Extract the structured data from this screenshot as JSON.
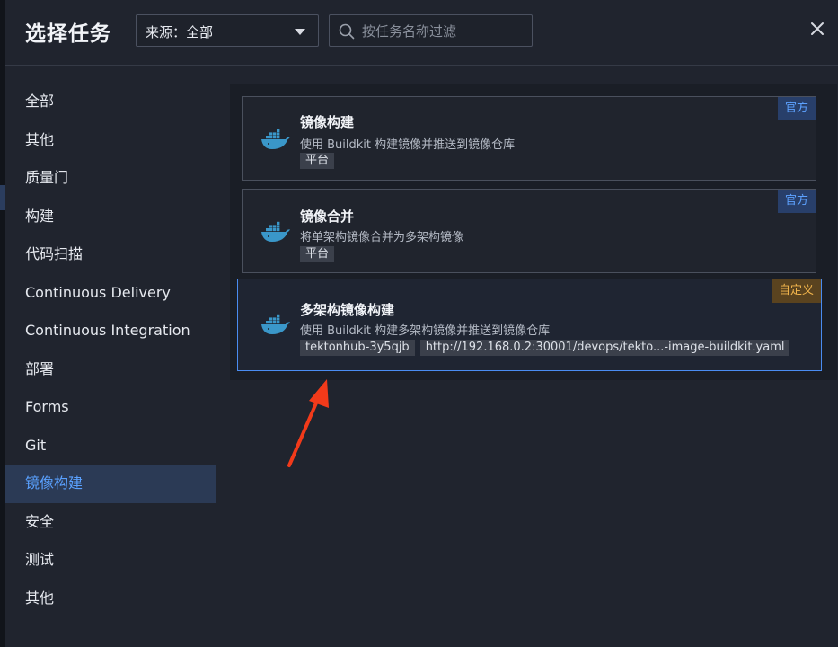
{
  "modal": {
    "title": "选择任务",
    "source_filter": {
      "label": "来源：全部"
    },
    "search": {
      "placeholder": "按任务名称过滤",
      "value": ""
    }
  },
  "sidebar": {
    "items": [
      {
        "label": "全部"
      },
      {
        "label": "其他"
      },
      {
        "label": "质量门"
      },
      {
        "label": "构建"
      },
      {
        "label": "代码扫描"
      },
      {
        "label": "Continuous Delivery"
      },
      {
        "label": "Continuous Integration"
      },
      {
        "label": "部署"
      },
      {
        "label": "Forms"
      },
      {
        "label": "Git"
      },
      {
        "label": "镜像构建",
        "active": true
      },
      {
        "label": "安全"
      },
      {
        "label": "测试"
      },
      {
        "label": "其他"
      }
    ]
  },
  "tasks": [
    {
      "name": "镜像构建",
      "description": "使用 Buildkit 构建镜像并推送到镜像仓库",
      "tags": [
        "平台"
      ],
      "badge": "官方",
      "icon": "docker-icon"
    },
    {
      "name": "镜像合并",
      "description": "将单架构镜像合并为多架构镜像",
      "tags": [
        "平台"
      ],
      "badge": "官方",
      "icon": "docker-icon"
    },
    {
      "name": "多架构镜像构建",
      "description": "使用 Buildkit 构建多架构镜像并推送到镜像仓库",
      "tags": [
        "tektonhub-3y5qjb",
        "http://192.168.0.2:30001/devops/tekto...-image-buildkit.yaml"
      ],
      "badge": "自定义",
      "icon": "docker-icon",
      "selected": true
    }
  ],
  "colors": {
    "accent": "#4a8cf0",
    "active_text": "#5aa1ff",
    "official_badge": "#5da2ff",
    "custom_badge": "#f2b54c",
    "annotation_arrow": "#f23a1a"
  }
}
